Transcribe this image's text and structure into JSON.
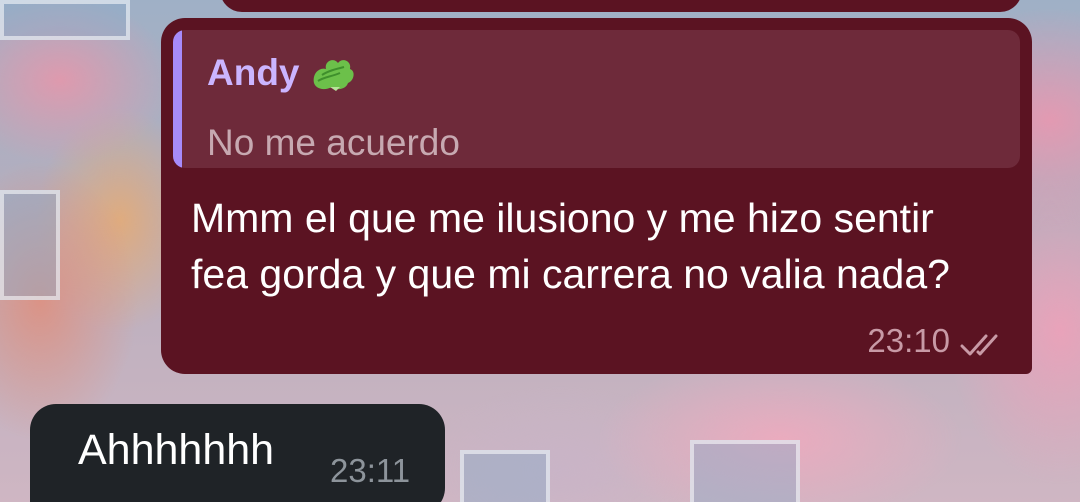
{
  "chat": {
    "outgoing": {
      "reply": {
        "author": "Andy",
        "author_emoji_icon": "lettuce-icon",
        "quoted_text": "No me acuerdo"
      },
      "text": "Mmm el que me ilusiono y me hizo sentir fea gorda y que mi carrera no valia nada?",
      "time": "23:10",
      "status_icon": "double-check-icon"
    },
    "incoming": {
      "text": "Ahhhhhhh",
      "time": "23:11"
    }
  },
  "colors": {
    "outgoing_bubble": "#5b1322",
    "reply_box": "#6e2a3a",
    "reply_bar": "#a78bfa",
    "reply_author": "#cbb5ff",
    "incoming_bubble": "#1f2327"
  }
}
